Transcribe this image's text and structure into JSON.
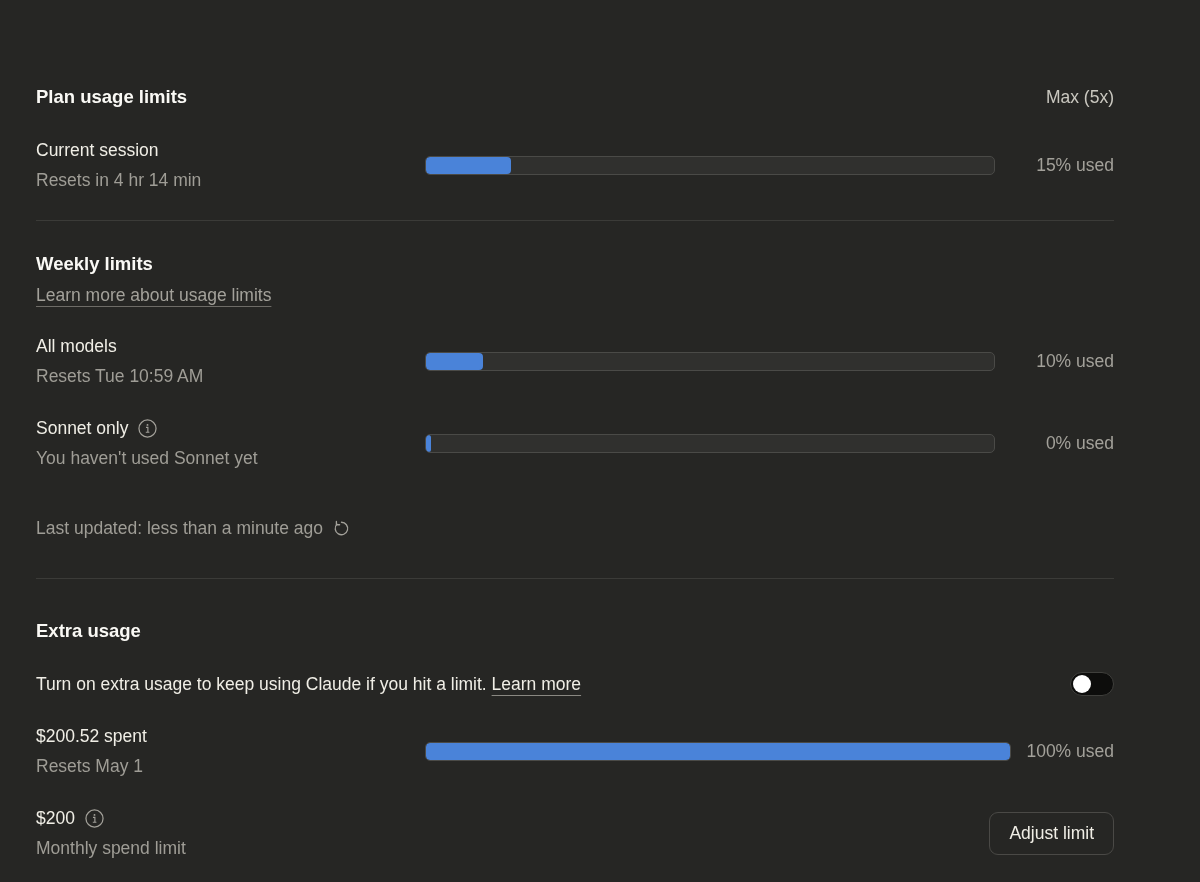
{
  "plan": {
    "title": "Plan usage limits",
    "plan_name": "Max (5x)",
    "meters": [
      {
        "label": "Current session",
        "info": false,
        "detail": "Resets in 4 hr 14 min",
        "level": 0.15,
        "reading": "15% used"
      }
    ]
  },
  "weekly": {
    "title": "Weekly limits",
    "link": "Learn more about usage limits",
    "meters": [
      {
        "label": "All models",
        "info": false,
        "detail": "Resets Tue 10:59 AM",
        "level": 0.1,
        "reading": "10% used"
      },
      {
        "label": "Sonnet only",
        "info": true,
        "detail": "You haven't used Sonnet yet",
        "level": 0,
        "reading": "0% used"
      }
    ],
    "last_updated": "Last updated: less than a minute ago"
  },
  "extra": {
    "title": "Extra usage",
    "description": "Turn on extra usage to keep using Claude if you hit a limit.",
    "link": "Learn more",
    "toggle": {
      "on": false
    },
    "meters": [
      {
        "label": "$200.52 spent",
        "info": false,
        "detail": "Resets May 1",
        "level": 1,
        "reading": "100% used"
      }
    ],
    "limit": {
      "amount": "$200",
      "detail": "Monthly spend limit",
      "button": "Adjust limit"
    }
  }
}
